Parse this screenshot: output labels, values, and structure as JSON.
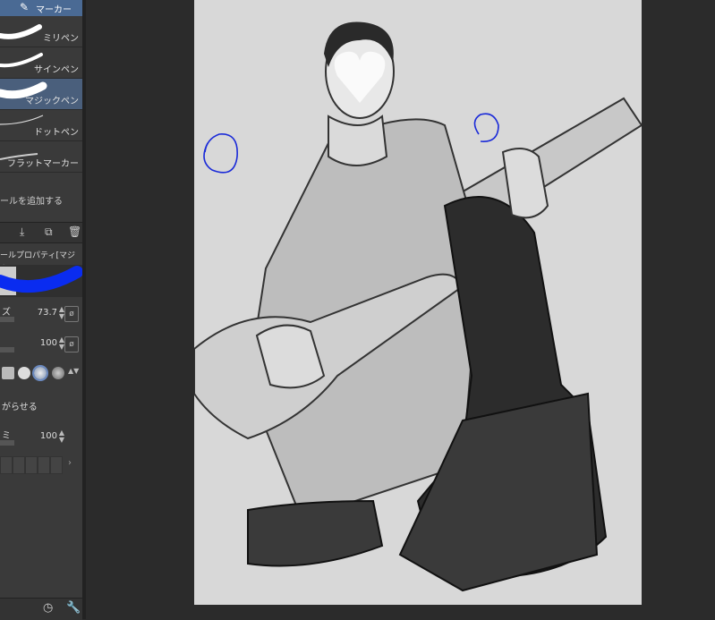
{
  "tool_group": {
    "label": "マーカー"
  },
  "brushes": [
    {
      "name": "ミリペン"
    },
    {
      "name": "サインペン"
    },
    {
      "name": "マジックペン"
    },
    {
      "name": "ドットペン"
    },
    {
      "name": "フラットマーカー"
    }
  ],
  "add_tool_label": "ールを追加する",
  "properties": {
    "header": "ールプロパティ[マジッ",
    "size_label": "ズ",
    "size_value": "73.7",
    "opacity_value": "100",
    "smooth_label": "がらせる",
    "density_label": "ミ",
    "density_value": "100"
  },
  "colors": {
    "accent": "#4a6a94",
    "stroke_preview": "#0a2cf0",
    "canvas_bg": "#d8d8d8"
  }
}
